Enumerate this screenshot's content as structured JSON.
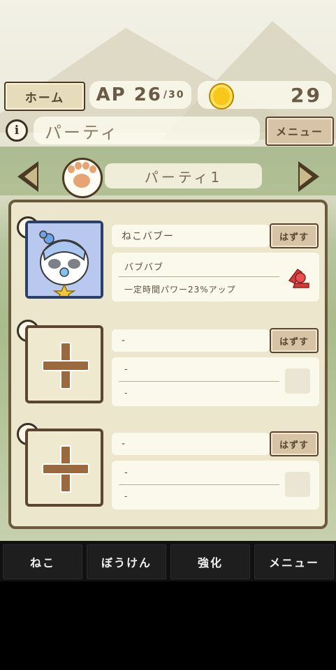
{
  "topbar": {
    "home_label": "ホーム",
    "ap_label": "AP",
    "ap_current": "26",
    "ap_max": "/30",
    "coins": "29",
    "coin_icon": "coin-icon"
  },
  "header": {
    "title": "パーティ",
    "menu_label": "メニュー"
  },
  "party_selector": {
    "name": "パーティ1"
  },
  "slots": [
    {
      "name": "ねこバブー",
      "remove_label": "はずす",
      "skill_name": "バブバブ",
      "skill_desc": "一定時間パワー23%アップ"
    },
    {
      "name": "-",
      "remove_label": "はずす",
      "skill_name": "-",
      "skill_desc": "-"
    },
    {
      "name": "-",
      "remove_label": "はずす",
      "skill_name": "-",
      "skill_desc": "-"
    }
  ],
  "navbar": {
    "items": [
      "ねこ",
      "ぼうけん",
      "強化",
      "メニュー"
    ]
  },
  "colors": {
    "panel": "#ece6cc",
    "frame": "#5a4630",
    "button": "#d7c4a6",
    "filled_frame": "#2a3f6a"
  }
}
